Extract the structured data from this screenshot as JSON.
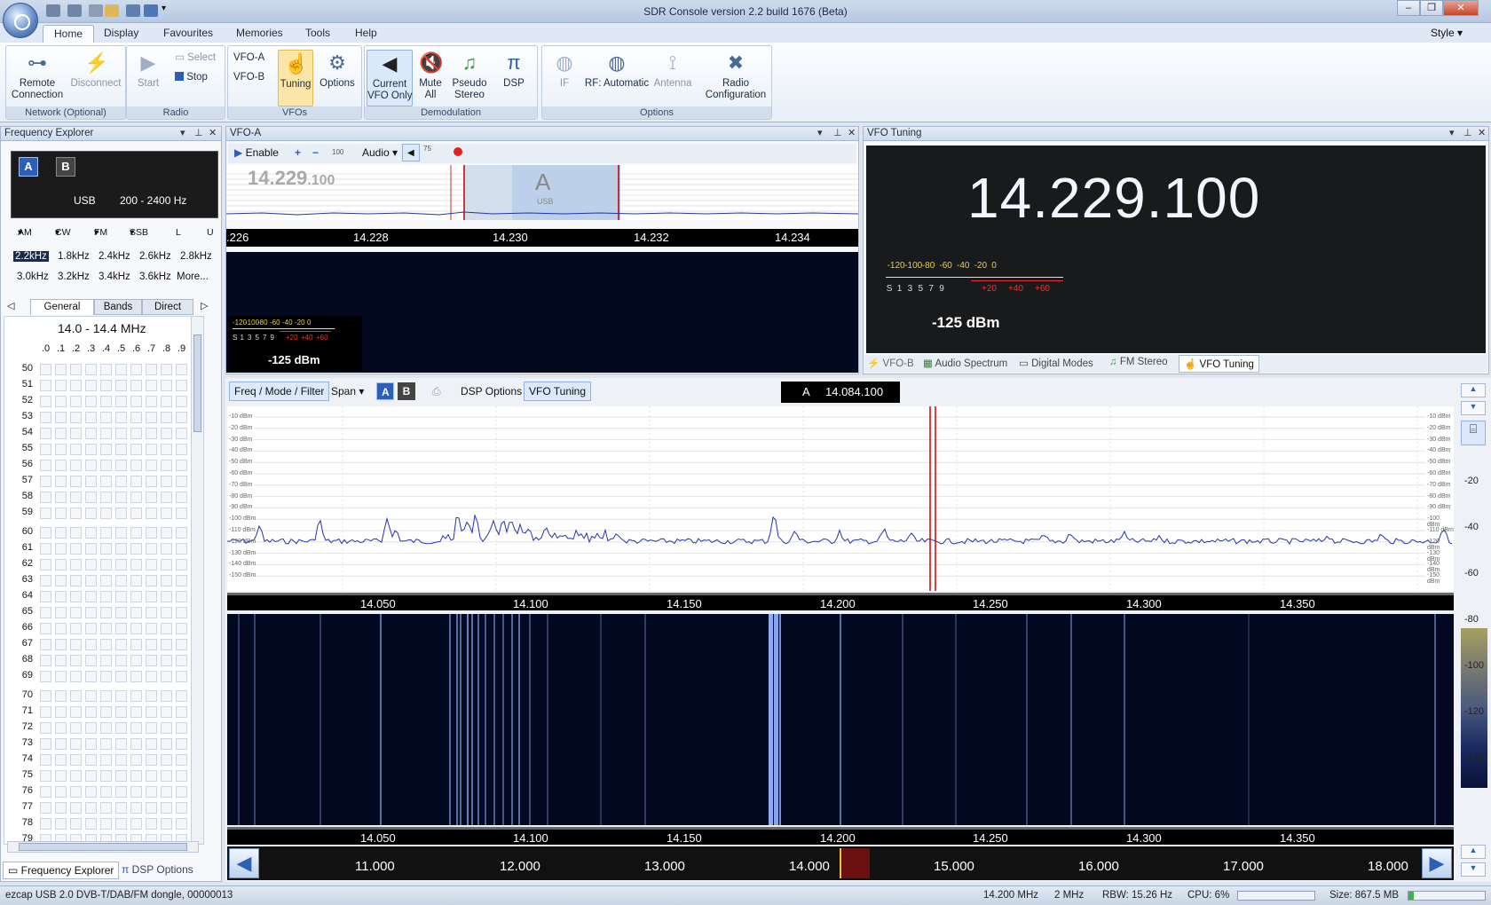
{
  "window": {
    "title": "SDR Console version 2.2 build 1676 (Beta)",
    "style_menu": "Style"
  },
  "ribbon": {
    "tabs": [
      "Home",
      "Display",
      "Favourites",
      "Memories",
      "Tools",
      "Help"
    ],
    "groups": {
      "network": "Network (Optional)",
      "radio": "Radio",
      "vfos": "VFOs",
      "demod": "Demodulation",
      "options": "Options"
    },
    "buttons": {
      "remote": "Remote\nConnection",
      "disconnect": "Disconnect",
      "start": "Start",
      "select": "Select",
      "stop": "Stop",
      "vfoa": "VFO-A",
      "vfob": "VFO-B",
      "tuning": "Tuning",
      "options": "Options",
      "current_vfo": "Current\nVFO Only",
      "mute": "Mute\nAll",
      "pseudo": "Pseudo\nStereo",
      "dsp": "DSP",
      "if": "IF",
      "rf": "RF: Automatic",
      "antenna": "Antenna",
      "radio_cfg": "Radio\nConfiguration"
    }
  },
  "freq_explorer": {
    "title": "Frequency Explorer",
    "mode": "USB",
    "filter": "200 - 2400 Hz",
    "modes": [
      "AM",
      "CW",
      "FM",
      "SSB",
      "L",
      "U"
    ],
    "bandwidths": [
      "2.2kHz",
      "1.8kHz",
      "2.4kHz",
      "2.6kHz",
      "2.8kHz",
      "3.0kHz",
      "3.2kHz",
      "3.4kHz",
      "3.6kHz",
      "More..."
    ],
    "tabs": [
      "General",
      "Bands",
      "Direct"
    ],
    "range": "14.0 - 14.4 MHz",
    "cols": [
      ".0",
      ".1",
      ".2",
      ".3",
      ".4",
      ".5",
      ".6",
      ".7",
      ".8",
      ".9"
    ],
    "rows": [
      "50",
      "51",
      "52",
      "53",
      "54",
      "55",
      "56",
      "57",
      "58",
      "59",
      "60",
      "61",
      "62",
      "63",
      "64",
      "65",
      "66",
      "67",
      "68",
      "69",
      "70",
      "71",
      "72",
      "73",
      "74",
      "75",
      "76",
      "77",
      "78",
      "79"
    ],
    "bottom_tabs": [
      "Frequency Explorer",
      "DSP Options"
    ]
  },
  "vfo_a": {
    "title": "VFO-A",
    "enable": "Enable",
    "step": "100",
    "audio": "Audio",
    "vol": "75",
    "freq_main": "14.229",
    "freq_sub": ".100",
    "marker": "A",
    "marker_mode": "USB",
    "axis": [
      ".226",
      "14.228",
      "14.230",
      "14.232",
      "14.234"
    ],
    "meter_scale": [
      "-120",
      "-100",
      "-80",
      "-60",
      "-40",
      "-20",
      "0"
    ],
    "meter_s": [
      "S",
      "1",
      "3",
      "5",
      "7",
      "9"
    ],
    "meter_plus": [
      "+20",
      "+40",
      "+60"
    ],
    "level": "-125 dBm"
  },
  "vfo_tuning": {
    "title": "VFO Tuning",
    "frequency": "14.229.100",
    "meter_scale": [
      "-120",
      "-100",
      "-80",
      "-60",
      "-40",
      "-20",
      "0"
    ],
    "meter_s": [
      "S",
      "1",
      "3",
      "5",
      "7",
      "9"
    ],
    "meter_plus": [
      "+20",
      "+40",
      "+60"
    ],
    "level": "-125 dBm",
    "tabs": [
      "VFO-B",
      "Audio Spectrum",
      "Digital Modes",
      "FM Stereo",
      "VFO Tuning"
    ]
  },
  "spectrum": {
    "toolbar": {
      "freq_mode": "Freq / Mode / Filter",
      "span": "Span",
      "a": "A",
      "b": "B",
      "dsp": "DSP Options",
      "vfo_tuning": "VFO Tuning"
    },
    "marker_label": "A",
    "marker_freq": "14.084.100",
    "dbm_ticks": [
      "-10 dBm",
      "-20 dBm",
      "-30 dBm",
      "-40 dBm",
      "-50 dBm",
      "-60 dBm",
      "-70 dBm",
      "-80 dBm",
      "-90 dBm",
      "-100 dBm",
      "-110 dBm",
      "-120 dBm",
      "-130 dBm",
      "-140 dBm",
      "-150 dBm"
    ],
    "axis": [
      "14.050",
      "14.100",
      "14.150",
      "14.200",
      "14.250",
      "14.300",
      "14.350"
    ],
    "right_scale": [
      "-20",
      "-40",
      "-60",
      "-80",
      "-100",
      "-120",
      "-140"
    ],
    "overview_axis": [
      "11.000",
      "12.000",
      "13.000",
      "14.000",
      "15.000",
      "16.000",
      "17.000",
      "18.000"
    ]
  },
  "status": {
    "device": "ezcap USB 2.0 DVB-T/DAB/FM dongle, 00000013",
    "freq": "14.200 MHz",
    "bw": "2 MHz",
    "rbw": "RBW: 15.26 Hz",
    "cpu": "CPU: 6%",
    "size": "Size: 867.5 MB"
  }
}
